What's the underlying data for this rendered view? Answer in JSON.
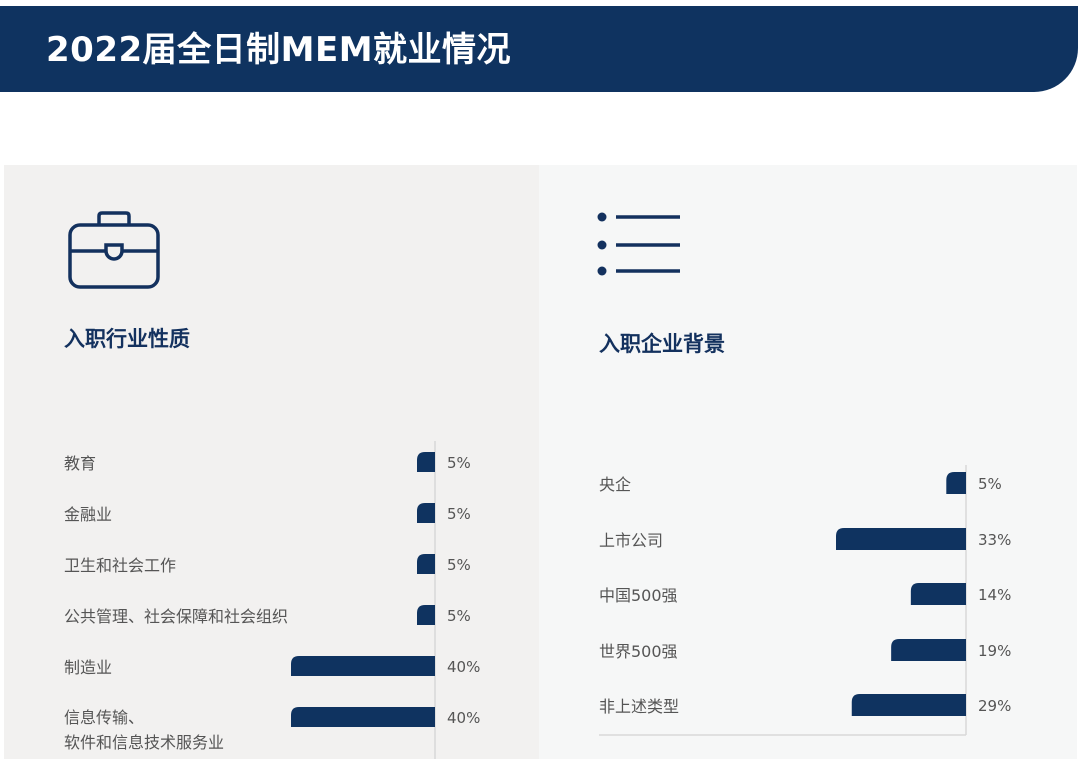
{
  "header": {
    "title": "2022届全日制MEM就业情况"
  },
  "theme": {
    "bar_color": "#0f3360",
    "axis_color": "#d8d8d8",
    "text_color": "#555555"
  },
  "left_panel": {
    "icon": "briefcase-icon",
    "title": "入职行业性质"
  },
  "right_panel": {
    "icon": "list-icon",
    "title": "入职企业背景"
  },
  "chart_data": [
    {
      "type": "bar",
      "orientation": "horizontal",
      "title": "入职行业性质",
      "categories": [
        [
          "教育"
        ],
        [
          "金融业"
        ],
        [
          "卫生和社会工作"
        ],
        [
          "公共管理、社会保障和社会组织"
        ],
        [
          "制造业"
        ],
        [
          "信息传输、",
          "软件和信息技术服务业"
        ]
      ],
      "values": [
        5,
        5,
        5,
        5,
        40,
        40
      ],
      "value_labels": [
        "5%",
        "5%",
        "5%",
        "5%",
        "40%",
        "40%"
      ],
      "unit": "%",
      "xlim": [
        0,
        40
      ]
    },
    {
      "type": "bar",
      "orientation": "horizontal",
      "title": "入职企业背景",
      "categories": [
        [
          "央企"
        ],
        [
          "上市公司"
        ],
        [
          "中国500强"
        ],
        [
          "世界500强"
        ],
        [
          "非上述类型"
        ]
      ],
      "values": [
        5,
        33,
        14,
        19,
        29
      ],
      "value_labels": [
        "5%",
        "33%",
        "14%",
        "19%",
        "29%"
      ],
      "unit": "%",
      "xlim": [
        0,
        33
      ]
    }
  ]
}
